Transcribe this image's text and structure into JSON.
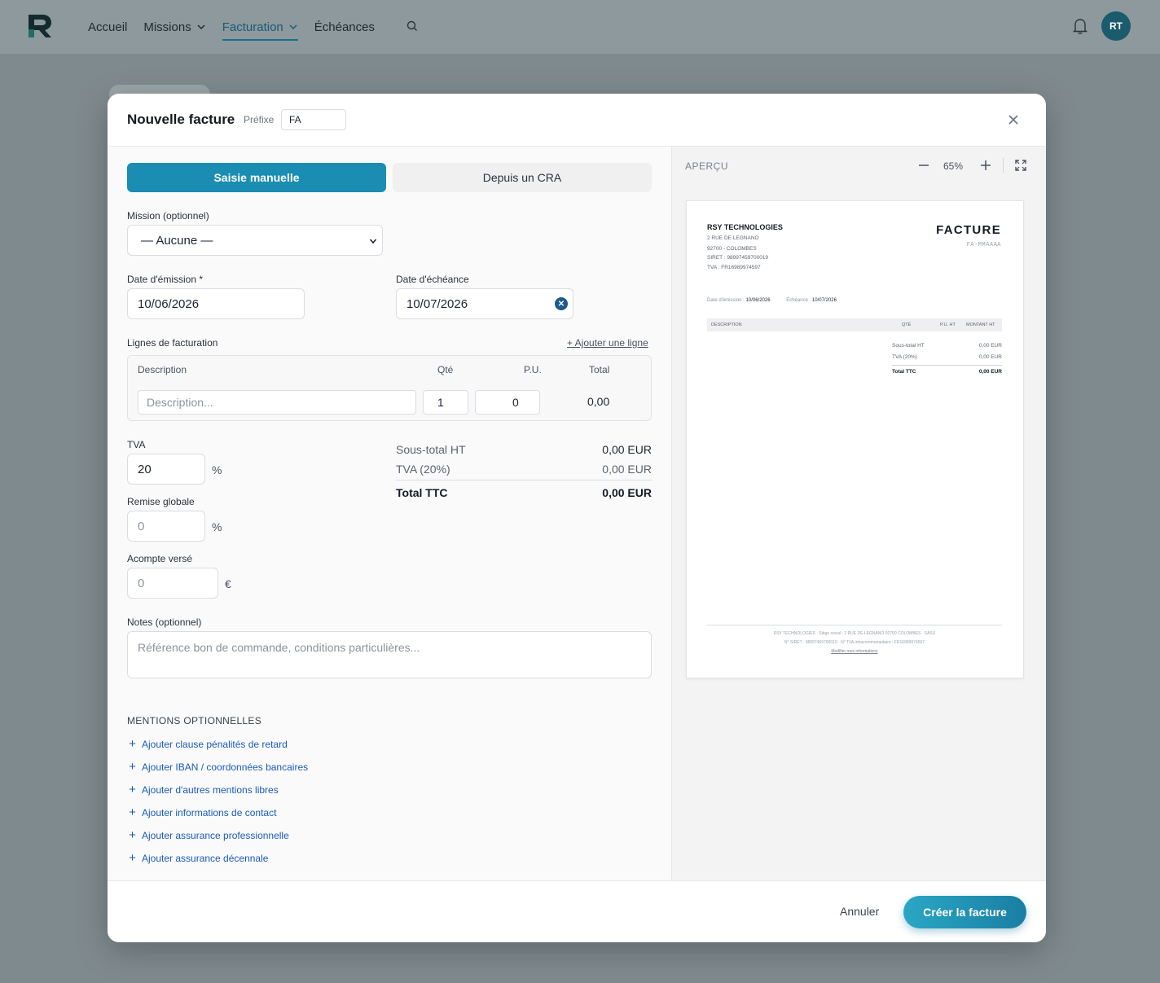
{
  "nav": {
    "items": [
      {
        "label": "Accueil",
        "chevron": false,
        "active": false
      },
      {
        "label": "Missions",
        "chevron": true,
        "active": false
      },
      {
        "label": "Facturation",
        "chevron": true,
        "active": true
      },
      {
        "label": "Échéances",
        "chevron": false,
        "active": false
      }
    ],
    "avatar_initials": "RT"
  },
  "modal": {
    "title": "Nouvelle facture",
    "prefix_label": "Préfixe",
    "prefix_value": "FA"
  },
  "form": {
    "tab_manual": "Saisie manuelle",
    "tab_cra": "Depuis un CRA",
    "mission_label": "Mission (optionnel)",
    "mission_value": "— Aucune —",
    "issue_date_label": "Date d'émission *",
    "issue_date_value": "10/06/2026",
    "due_date_label": "Date d'échéance",
    "due_date_value": "10/07/2026",
    "lines_label": "Lignes de facturation",
    "add_line": "+ Ajouter une ligne",
    "columns": {
      "description": "Description",
      "qty": "Qté",
      "pu": "P.U.",
      "total": "Total"
    },
    "line": {
      "description_placeholder": "Description...",
      "qty": "1",
      "pu": "0",
      "total": "0,00"
    },
    "tva_label": "TVA",
    "tva_value": "20",
    "percent": "%",
    "discount_label": "Remise globale",
    "discount_placeholder": "0",
    "deposit_label": "Acompte versé",
    "deposit_placeholder": "0",
    "euro": "€",
    "notes_label": "Notes (optionnel)",
    "notes_placeholder": "Référence bon de commande, conditions particulières...",
    "mentions_title": "MENTIONS OPTIONNELLES",
    "mentions": [
      "Ajouter clause pénalités de retard",
      "Ajouter IBAN / coordonnées bancaires",
      "Ajouter d'autres mentions libres",
      "Ajouter informations de contact",
      "Ajouter assurance professionnelle",
      "Ajouter assurance décennale"
    ]
  },
  "summary": {
    "subtotal_label": "Sous-total HT",
    "subtotal_value": "0,00 EUR",
    "tva_label": "TVA (20%)",
    "tva_value": "0,00 EUR",
    "total_label": "Total TTC",
    "total_value": "0,00 EUR"
  },
  "preview": {
    "label": "APERÇU",
    "zoom": "65%",
    "company": "RSY TECHNOLOGIES",
    "address_lines": [
      "2 RUE DE LEGNANO",
      "92700 - COLOMBES",
      "SIRET : 98997459700019",
      "TVA : FR16989974597"
    ],
    "doc_title": "FACTURE",
    "doc_number": "FA-MMAAAA",
    "issue_label": "Date d'émission :",
    "issue_value": "10/06/2026",
    "due_label": "Échéance :",
    "due_value": "10/07/2026",
    "table_headers": {
      "description": "DESCRIPTION",
      "qty": "QTÉ",
      "pu": "P.U. HT",
      "amount": "MONTANT HT"
    },
    "subtotal_label": "Sous-total HT",
    "subtotal_value": "0,00 EUR",
    "tva_label": "TVA (20%)",
    "tva_value": "0,00 EUR",
    "total_label": "Total TTC",
    "total_value": "0,00 EUR",
    "footer_line1": "RSY TECHNOLOGIES · Siège social : 2 RUE DE LEGNANO 92700 COLOMBES · SASU",
    "footer_line2": "N° SIRET : 98997459700019 · N° TVA intracommunautaire : FR16989974597",
    "footer_link": "Modifier mes informations"
  },
  "footer": {
    "cancel": "Annuler",
    "create": "Créer la facture"
  },
  "colors": {
    "accent": "#1b8db3",
    "link": "#1a5bb8",
    "active_nav": "#1a5b7a"
  }
}
